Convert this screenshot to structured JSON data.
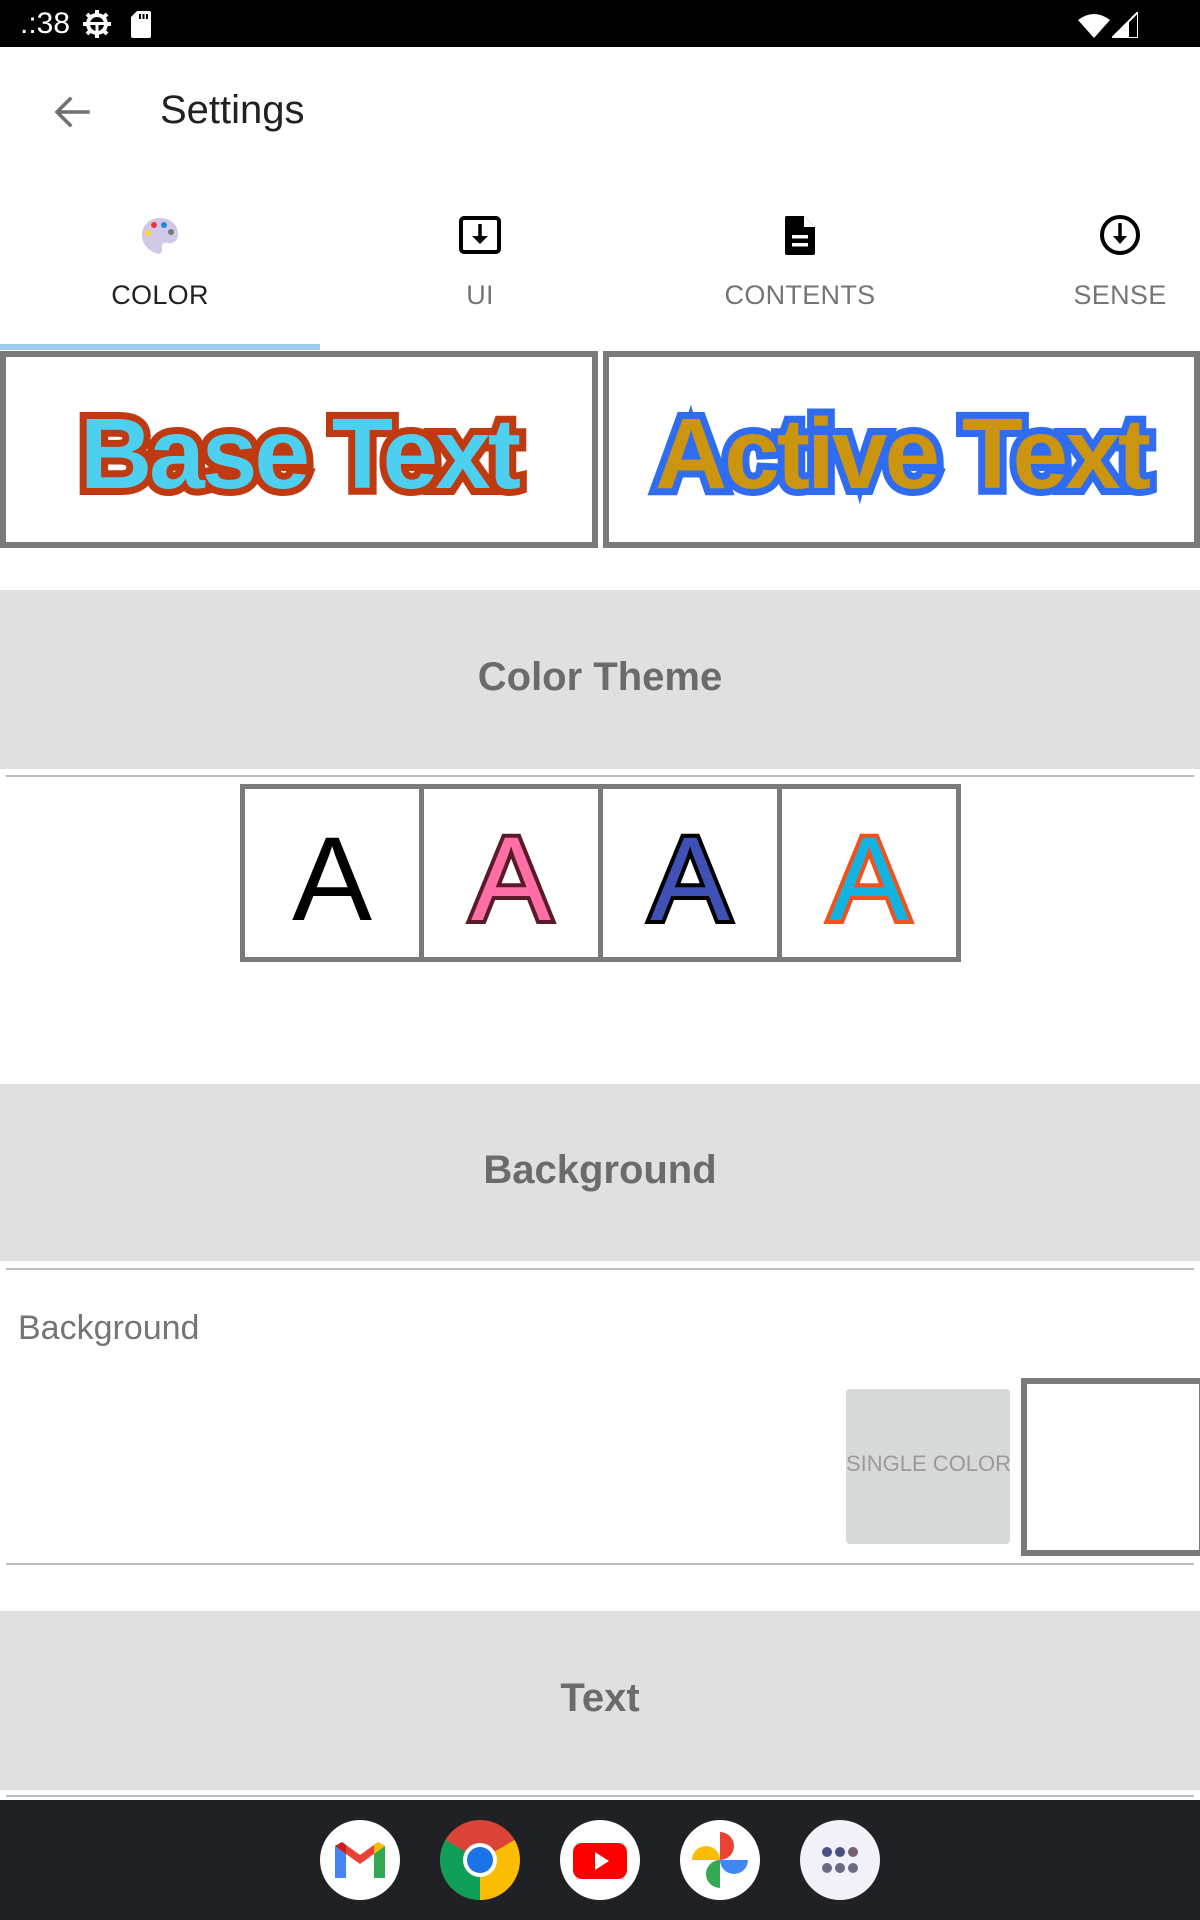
{
  "status_bar": {
    "time": ".:38",
    "icons": [
      "gear-icon",
      "sd-card-icon",
      "wifi-icon",
      "cell-signal-icon"
    ]
  },
  "app_bar": {
    "back_icon": "arrow-back-icon",
    "title": "Settings"
  },
  "tabs": [
    {
      "label": "COLOR",
      "icon": "palette-icon",
      "active": true
    },
    {
      "label": "UI",
      "icon": "download-box-icon",
      "active": false
    },
    {
      "label": "CONTENTS",
      "icon": "document-icon",
      "active": false
    },
    {
      "label": "SENSE",
      "icon": "download-circle-icon",
      "active": false
    }
  ],
  "preview": {
    "base_text": "Base Text",
    "active_text": "Active Text",
    "base_colors": {
      "fill": "#4dd0f0",
      "outline": "#bf3a10"
    },
    "active_colors": {
      "fill": "#cc9510",
      "outline": "#2f6cf0"
    }
  },
  "sections": {
    "color_theme": "Color Theme",
    "background": "Background",
    "text": "Text"
  },
  "color_themes": [
    {
      "glyph": "A",
      "fill": "#000000",
      "outline": "none"
    },
    {
      "glyph": "A",
      "fill": "#ff6fa5",
      "outline": "#5a1a2a"
    },
    {
      "glyph": "A",
      "fill": "#3f51b5",
      "outline": "#000000"
    },
    {
      "glyph": "A",
      "fill": "#12b3e0",
      "outline": "#f0521e"
    }
  ],
  "background_row": {
    "label": "Background",
    "single_color_button": "SINGLE COLOR",
    "swatch_color": "#ffffff"
  },
  "dock": [
    {
      "name": "Gmail",
      "icon": "gmail-icon"
    },
    {
      "name": "Chrome",
      "icon": "chrome-icon"
    },
    {
      "name": "YouTube",
      "icon": "youtube-icon"
    },
    {
      "name": "Photos",
      "icon": "photos-icon"
    },
    {
      "name": "App drawer",
      "icon": "app-drawer-icon"
    }
  ],
  "colors": {
    "tab_indicator": "#9ecbeb",
    "section_header_bg": "#e0e0e0",
    "box_border": "#7a7a7a"
  }
}
